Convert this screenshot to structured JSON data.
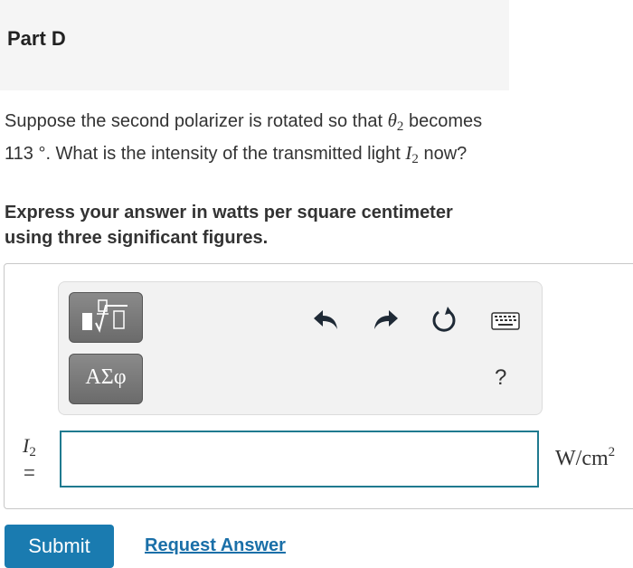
{
  "header": {
    "part_title": "Part D"
  },
  "question": {
    "text_1": "Suppose the second polarizer is rotated so that ",
    "theta_symbol": "θ",
    "theta_sub": "2",
    "text_2": "becomes 113 °. What is the intensity of the transmitted light ",
    "i_symbol": "I",
    "i_sub": "2",
    "text_3": " now?"
  },
  "instruction": "Express your answer in watts per square centimeter using three significant figures.",
  "toolbar": {
    "templates_icon": "fraction-root-template-icon",
    "greek_label": "ΑΣφ",
    "undo_icon": "undo-icon",
    "redo_icon": "redo-icon",
    "reset_icon": "reset-icon",
    "keyboard_icon": "keyboard-icon",
    "help_label": "?"
  },
  "answer": {
    "var_symbol": "I",
    "var_sub": "2",
    "equals": "=",
    "value": "",
    "unit_main": "W/cm",
    "unit_sup": "2"
  },
  "actions": {
    "submit_label": "Submit",
    "request_label": "Request Answer"
  },
  "colors": {
    "accent": "#1a7bb0",
    "input_border": "#1f7a8f",
    "toolbar_button": "#6b6b6b"
  }
}
